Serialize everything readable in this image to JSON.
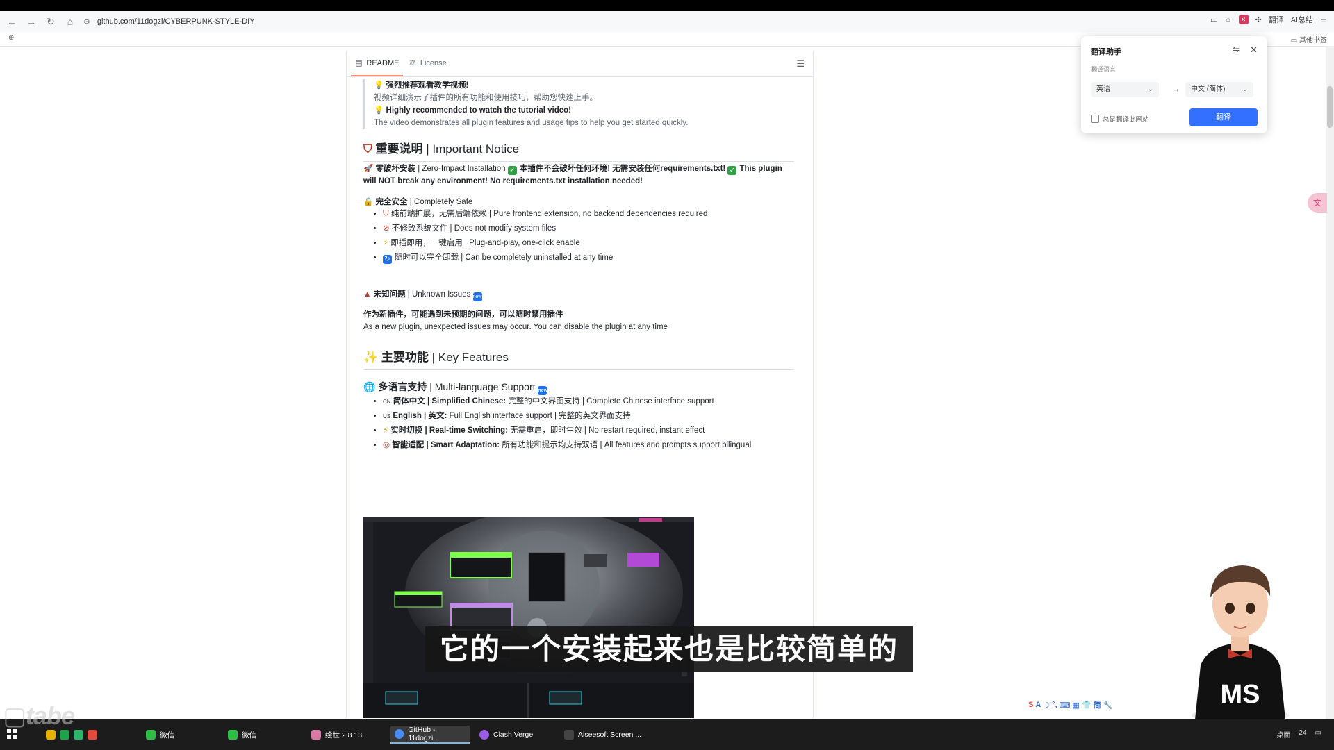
{
  "browser": {
    "url": "github.com/11dogzi/CYBERPUNK-STYLE-DIY",
    "right_items": [
      "翻译",
      "AI总结"
    ],
    "bookmarks_right": "其他书签"
  },
  "tabs": {
    "readme": "README",
    "license": "License"
  },
  "quote": {
    "line1": "强烈推荐观看教学视频!",
    "line2": "视频详细演示了插件的所有功能和使用技巧，帮助您快速上手。",
    "line3": "Highly recommended to watch the tutorial video!",
    "line4": "The video demonstrates all plugin features and usage tips to help you get started quickly."
  },
  "notice": {
    "heading_cn": "重要说明",
    "heading_en": "| Important Notice",
    "zero_impact_cn": "零破坏安装",
    "zero_impact_en": "| Zero-Impact Installation",
    "zero_impact_text_cn": "本插件不会破坏任何环境! 无需安装任何requirements.txt!",
    "zero_impact_text_en_1": "This",
    "zero_impact_text_en_2": "plugin will NOT break any environment! No requirements.txt installation needed!",
    "safe_cn": "完全安全",
    "safe_en": "| Completely Safe",
    "safe_items": [
      "纯前端扩展，无需后端依赖 | Pure frontend extension, no backend dependencies required",
      "不修改系统文件 | Does not modify system files",
      "即插即用，一键启用 | Plug-and-play, one-click enable",
      "随时可以完全卸载 | Can be completely uninstalled at any time"
    ],
    "unknown_cn": "未知问题",
    "unknown_en": "| Unknown Issues",
    "unknown_text_cn": "作为新插件，可能遇到未预期的问题，可以随时禁用插件",
    "unknown_text_en": "As a new plugin, unexpected issues may occur. You can disable the plugin at any time"
  },
  "features": {
    "heading_cn": "主要功能",
    "heading_en": "| Key Features",
    "multilang_cn": "多语言支持",
    "multilang_en": "| Multi-language Support",
    "items": [
      {
        "flag": "CN",
        "label": "简体中文 | Simplified Chinese:",
        "text": "完整的中文界面支持 | Complete Chinese interface support"
      },
      {
        "flag": "US",
        "label": "English | 英文:",
        "text": "Full English interface support | 完整的英文界面支持"
      },
      {
        "flag": "⚡",
        "label": "实时切换 | Real-time Switching:",
        "text": "无需重启，即时生效 | No restart required, instant effect"
      },
      {
        "flag": "◎",
        "label": "智能适配 | Smart Adaptation:",
        "text": "所有功能和提示均支持双语 | All features and prompts support bilingual"
      }
    ]
  },
  "translator": {
    "title": "翻译助手",
    "sub": "翻译语言",
    "from": "英语",
    "to": "中文 (简体)",
    "always": "总是翻译此网站",
    "button": "翻译"
  },
  "subtitle": "它的一个安装起来也是比较简单的",
  "taskbar": {
    "items": [
      "微信",
      "微信",
      "绘世 2.8.13",
      "GitHub - 11dogzi...",
      "Clash Verge",
      "Aiseesoft Screen ..."
    ],
    "right": [
      "桌面",
      "24"
    ]
  },
  "avatar_text": "MS",
  "colors": {
    "accent_blue": "#3370ff",
    "tab_underline": "#fd8c73"
  }
}
